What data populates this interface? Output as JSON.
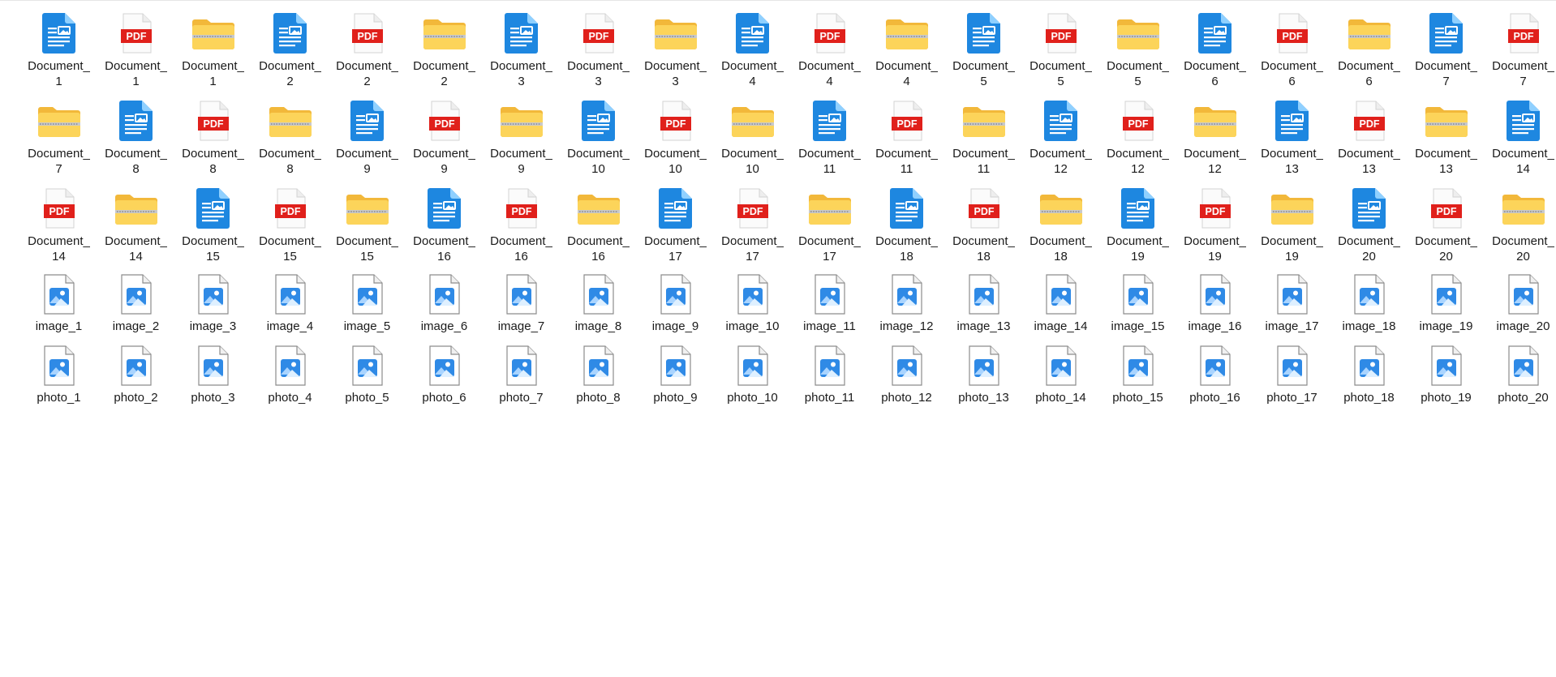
{
  "colors": {
    "doc_blue": "#1e87e0",
    "pdf_red": "#e0201b",
    "zip_folder_yellow": "#fcd45a",
    "image_blue": "#2f8ae6",
    "label_text": "#1a1a1a"
  },
  "icons": {
    "doc": "word-document-icon",
    "pdf": "pdf-file-icon",
    "zip": "zip-folder-icon",
    "img": "image-file-icon"
  },
  "pdf_badge": "PDF",
  "files": [
    {
      "type": "doc",
      "label": "Document_\n1"
    },
    {
      "type": "pdf",
      "label": "Document_\n1"
    },
    {
      "type": "zip",
      "label": "Document_\n1"
    },
    {
      "type": "doc",
      "label": "Document_\n2"
    },
    {
      "type": "pdf",
      "label": "Document_\n2"
    },
    {
      "type": "zip",
      "label": "Document_\n2"
    },
    {
      "type": "doc",
      "label": "Document_\n3"
    },
    {
      "type": "pdf",
      "label": "Document_\n3"
    },
    {
      "type": "zip",
      "label": "Document_\n3"
    },
    {
      "type": "doc",
      "label": "Document_\n4"
    },
    {
      "type": "pdf",
      "label": "Document_\n4"
    },
    {
      "type": "zip",
      "label": "Document_\n4"
    },
    {
      "type": "doc",
      "label": "Document_\n5"
    },
    {
      "type": "pdf",
      "label": "Document_\n5"
    },
    {
      "type": "zip",
      "label": "Document_\n5"
    },
    {
      "type": "doc",
      "label": "Document_\n6"
    },
    {
      "type": "pdf",
      "label": "Document_\n6"
    },
    {
      "type": "zip",
      "label": "Document_\n6"
    },
    {
      "type": "doc",
      "label": "Document_\n7"
    },
    {
      "type": "pdf",
      "label": "Document_\n7"
    },
    {
      "type": "zip",
      "label": "Document_\n7"
    },
    {
      "type": "doc",
      "label": "Document_\n8"
    },
    {
      "type": "pdf",
      "label": "Document_\n8"
    },
    {
      "type": "zip",
      "label": "Document_\n8"
    },
    {
      "type": "doc",
      "label": "Document_\n9"
    },
    {
      "type": "pdf",
      "label": "Document_\n9"
    },
    {
      "type": "zip",
      "label": "Document_\n9"
    },
    {
      "type": "doc",
      "label": "Document_\n10"
    },
    {
      "type": "pdf",
      "label": "Document_\n10"
    },
    {
      "type": "zip",
      "label": "Document_\n10"
    },
    {
      "type": "doc",
      "label": "Document_\n11"
    },
    {
      "type": "pdf",
      "label": "Document_\n11"
    },
    {
      "type": "zip",
      "label": "Document_\n11"
    },
    {
      "type": "doc",
      "label": "Document_\n12"
    },
    {
      "type": "pdf",
      "label": "Document_\n12"
    },
    {
      "type": "zip",
      "label": "Document_\n12"
    },
    {
      "type": "doc",
      "label": "Document_\n13"
    },
    {
      "type": "pdf",
      "label": "Document_\n13"
    },
    {
      "type": "zip",
      "label": "Document_\n13"
    },
    {
      "type": "doc",
      "label": "Document_\n14"
    },
    {
      "type": "pdf",
      "label": "Document_\n14"
    },
    {
      "type": "zip",
      "label": "Document_\n14"
    },
    {
      "type": "doc",
      "label": "Document_\n15"
    },
    {
      "type": "pdf",
      "label": "Document_\n15"
    },
    {
      "type": "zip",
      "label": "Document_\n15"
    },
    {
      "type": "doc",
      "label": "Document_\n16"
    },
    {
      "type": "pdf",
      "label": "Document_\n16"
    },
    {
      "type": "zip",
      "label": "Document_\n16"
    },
    {
      "type": "doc",
      "label": "Document_\n17"
    },
    {
      "type": "pdf",
      "label": "Document_\n17"
    },
    {
      "type": "zip",
      "label": "Document_\n17"
    },
    {
      "type": "doc",
      "label": "Document_\n18"
    },
    {
      "type": "pdf",
      "label": "Document_\n18"
    },
    {
      "type": "zip",
      "label": "Document_\n18"
    },
    {
      "type": "doc",
      "label": "Document_\n19"
    },
    {
      "type": "pdf",
      "label": "Document_\n19"
    },
    {
      "type": "zip",
      "label": "Document_\n19"
    },
    {
      "type": "doc",
      "label": "Document_\n20"
    },
    {
      "type": "pdf",
      "label": "Document_\n20"
    },
    {
      "type": "zip",
      "label": "Document_\n20"
    },
    {
      "type": "img",
      "label": "image_1"
    },
    {
      "type": "img",
      "label": "image_2"
    },
    {
      "type": "img",
      "label": "image_3"
    },
    {
      "type": "img",
      "label": "image_4"
    },
    {
      "type": "img",
      "label": "image_5"
    },
    {
      "type": "img",
      "label": "image_6"
    },
    {
      "type": "img",
      "label": "image_7"
    },
    {
      "type": "img",
      "label": "image_8"
    },
    {
      "type": "img",
      "label": "image_9"
    },
    {
      "type": "img",
      "label": "image_10"
    },
    {
      "type": "img",
      "label": "image_11"
    },
    {
      "type": "img",
      "label": "image_12"
    },
    {
      "type": "img",
      "label": "image_13"
    },
    {
      "type": "img",
      "label": "image_14"
    },
    {
      "type": "img",
      "label": "image_15"
    },
    {
      "type": "img",
      "label": "image_16"
    },
    {
      "type": "img",
      "label": "image_17"
    },
    {
      "type": "img",
      "label": "image_18"
    },
    {
      "type": "img",
      "label": "image_19"
    },
    {
      "type": "img",
      "label": "image_20"
    },
    {
      "type": "img",
      "label": "photo_1"
    },
    {
      "type": "img",
      "label": "photo_2"
    },
    {
      "type": "img",
      "label": "photo_3"
    },
    {
      "type": "img",
      "label": "photo_4"
    },
    {
      "type": "img",
      "label": "photo_5"
    },
    {
      "type": "img",
      "label": "photo_6"
    },
    {
      "type": "img",
      "label": "photo_7"
    },
    {
      "type": "img",
      "label": "photo_8"
    },
    {
      "type": "img",
      "label": "photo_9"
    },
    {
      "type": "img",
      "label": "photo_10"
    },
    {
      "type": "img",
      "label": "photo_11"
    },
    {
      "type": "img",
      "label": "photo_12"
    },
    {
      "type": "img",
      "label": "photo_13"
    },
    {
      "type": "img",
      "label": "photo_14"
    },
    {
      "type": "img",
      "label": "photo_15"
    },
    {
      "type": "img",
      "label": "photo_16"
    },
    {
      "type": "img",
      "label": "photo_17"
    },
    {
      "type": "img",
      "label": "photo_18"
    },
    {
      "type": "img",
      "label": "photo_19"
    },
    {
      "type": "img",
      "label": "photo_20"
    }
  ]
}
